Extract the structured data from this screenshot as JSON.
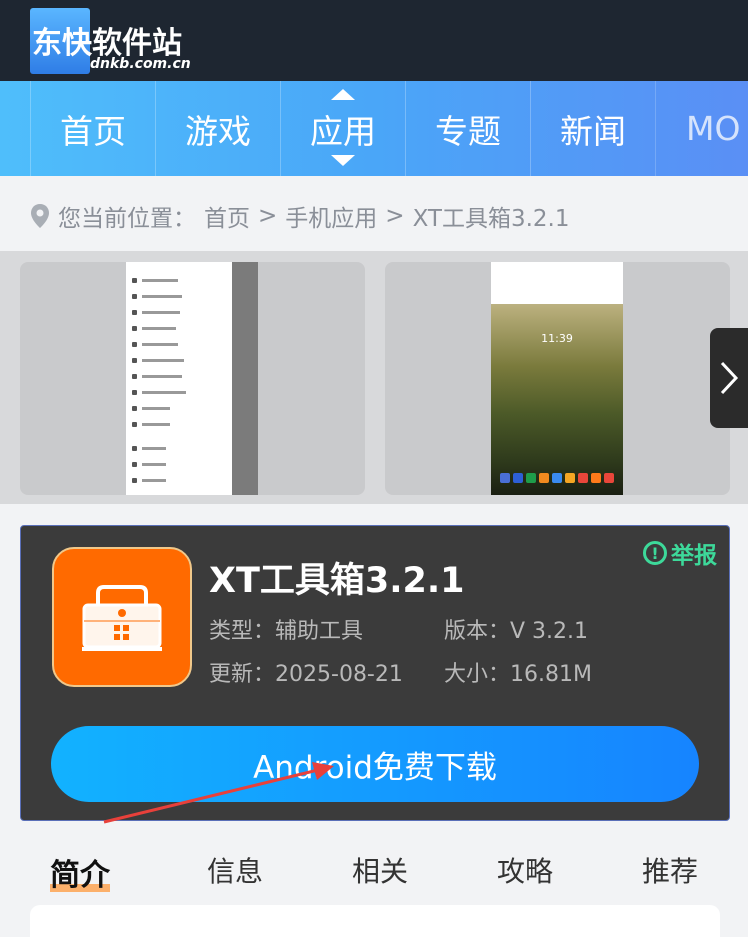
{
  "logo": {
    "title": "东快软件站",
    "domain": "dnkb.com.cn"
  },
  "nav": {
    "items": [
      "首页",
      "游戏",
      "应用",
      "专题",
      "新闻",
      "MO"
    ],
    "active_index": 2
  },
  "breadcrumb": {
    "prefix": "您当前位置：",
    "items": [
      "首页",
      "手机应用",
      "XT工具箱3.2.1"
    ],
    "separator": ">"
  },
  "screenshots": {
    "clock": "11:39"
  },
  "app": {
    "name": "XT工具箱3.2.1",
    "report_label": "举报",
    "type_label": "类型：",
    "type_value": "辅助工具",
    "version_label": "版本：",
    "version_value": "V 3.2.1",
    "updated_label": "更新：",
    "updated_value": "2025-08-21",
    "size_label": "大小：",
    "size_value": "16.81M",
    "download_label": "Android免费下载",
    "icon_color": "#ff6a00"
  },
  "tabs": {
    "items": [
      "简介",
      "信息",
      "相关",
      "攻略",
      "推荐"
    ],
    "active_index": 0
  },
  "colors": {
    "accent": "#1684ff",
    "report": "#3dd99a",
    "header": "#1e2631"
  }
}
